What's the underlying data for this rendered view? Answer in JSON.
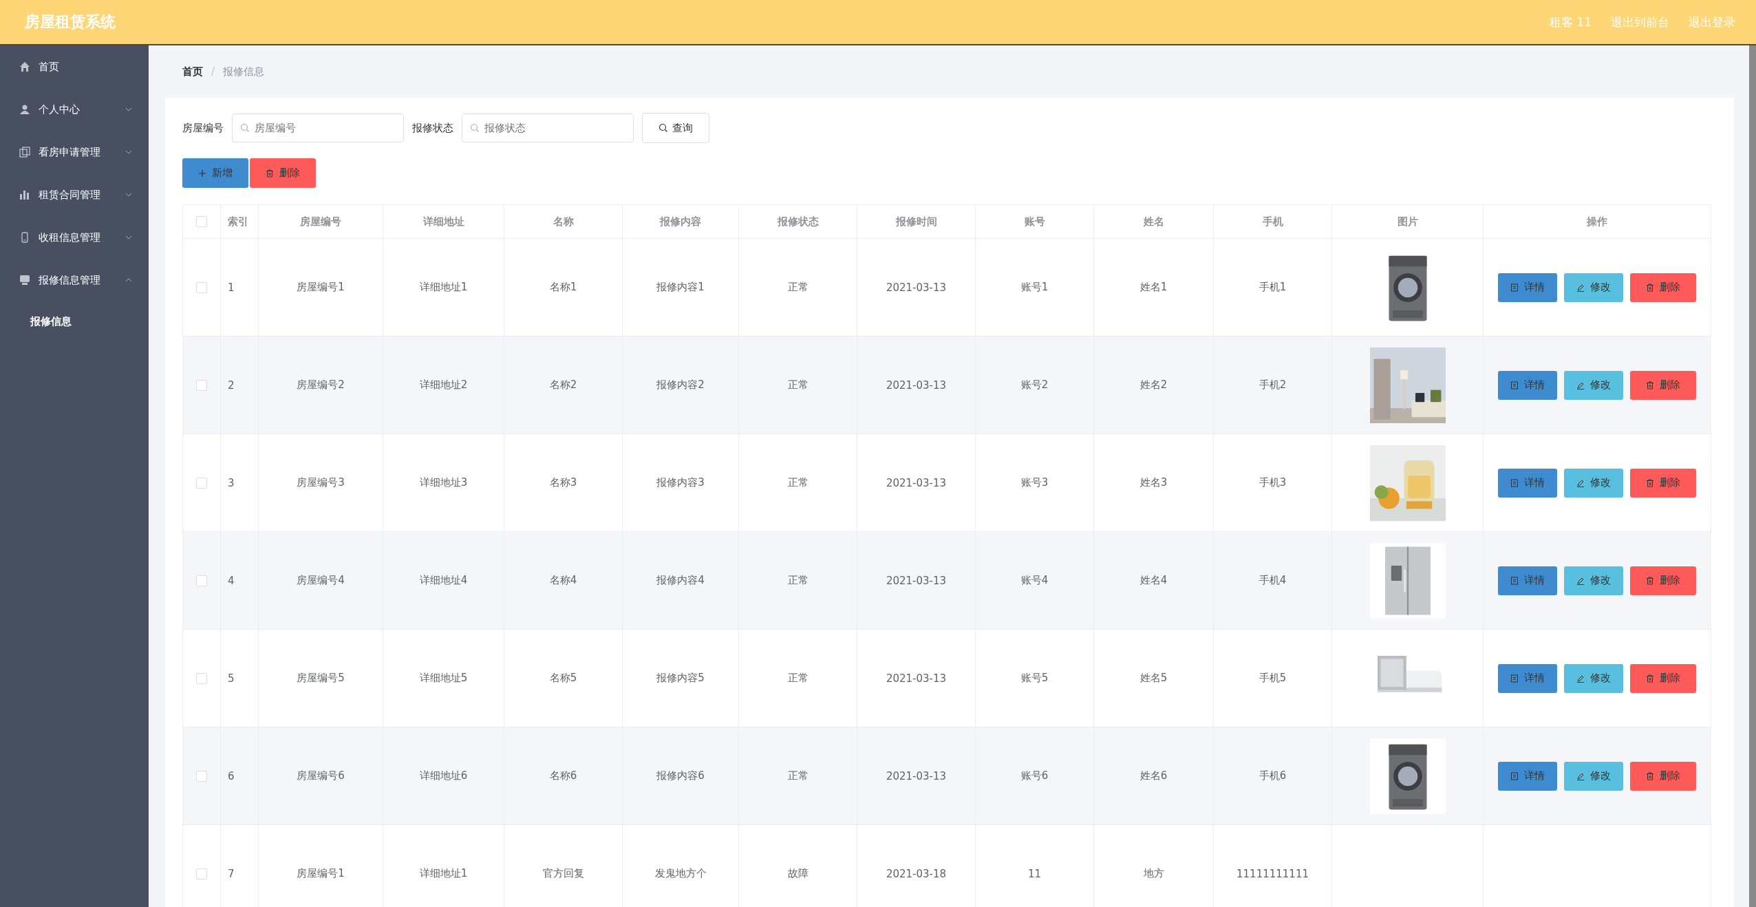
{
  "header": {
    "title": "房屋租赁系统",
    "links": [
      {
        "label": "租客 11"
      },
      {
        "label": "退出到前台"
      },
      {
        "label": "退出登录"
      }
    ]
  },
  "sidebar": {
    "items": [
      {
        "label": "首页"
      },
      {
        "label": "个人中心",
        "expanded": false
      },
      {
        "label": "看房申请管理",
        "expanded": false
      },
      {
        "label": "租赁合同管理",
        "expanded": false
      },
      {
        "label": "收租信息管理",
        "expanded": false
      },
      {
        "label": "报修信息管理",
        "expanded": true,
        "children": [
          {
            "label": "报修信息",
            "selected": true
          }
        ]
      }
    ]
  },
  "breadcrumb": {
    "separator": "/",
    "items": [
      {
        "label": "首页"
      },
      {
        "label": "报修信息"
      }
    ]
  },
  "search": {
    "fields": [
      {
        "label": "房屋编号",
        "placeholder": "房屋编号"
      },
      {
        "label": "报修状态",
        "placeholder": "报修状态"
      }
    ],
    "button": "查询"
  },
  "toolbar": [
    {
      "kind": "add",
      "label": "新增"
    },
    {
      "kind": "delete",
      "label": "删除"
    }
  ],
  "table": {
    "header_checked": false,
    "columns": [
      "索引",
      "房屋编号",
      "详细地址",
      "名称",
      "报修内容",
      "报修状态",
      "报修时间",
      "账号",
      "姓名",
      "手机",
      "图片",
      "操作"
    ],
    "rows": [
      {
        "checked": false,
        "cells": [
          "1",
          "房屋编号1",
          "详细地址1",
          "名称1",
          "报修内容1",
          "正常",
          "2021-03-13",
          "账号1",
          "姓名1",
          "手机1"
        ],
        "actions": [
          {
            "kind": "detail",
            "label": "详情"
          },
          {
            "kind": "edit",
            "label": "修改"
          },
          {
            "kind": "delete",
            "label": "删除"
          }
        ]
      },
      {
        "checked": false,
        "cells": [
          "2",
          "房屋编号2",
          "详细地址2",
          "名称2",
          "报修内容2",
          "正常",
          "2021-03-13",
          "账号2",
          "姓名2",
          "手机2"
        ],
        "actions": [
          {
            "kind": "detail",
            "label": "详情"
          },
          {
            "kind": "edit",
            "label": "修改"
          },
          {
            "kind": "delete",
            "label": "删除"
          }
        ]
      },
      {
        "checked": false,
        "cells": [
          "3",
          "房屋编号3",
          "详细地址3",
          "名称3",
          "报修内容3",
          "正常",
          "2021-03-13",
          "账号3",
          "姓名3",
          "手机3"
        ],
        "actions": [
          {
            "kind": "detail",
            "label": "详情"
          },
          {
            "kind": "edit",
            "label": "修改"
          },
          {
            "kind": "delete",
            "label": "删除"
          }
        ]
      },
      {
        "checked": false,
        "cells": [
          "4",
          "房屋编号4",
          "详细地址4",
          "名称4",
          "报修内容4",
          "正常",
          "2021-03-13",
          "账号4",
          "姓名4",
          "手机4"
        ],
        "actions": [
          {
            "kind": "detail",
            "label": "详情"
          },
          {
            "kind": "edit",
            "label": "修改"
          },
          {
            "kind": "delete",
            "label": "删除"
          }
        ]
      },
      {
        "checked": false,
        "cells": [
          "5",
          "房屋编号5",
          "详细地址5",
          "名称5",
          "报修内容5",
          "正常",
          "2021-03-13",
          "账号5",
          "姓名5",
          "手机5"
        ],
        "actions": [
          {
            "kind": "detail",
            "label": "详情"
          },
          {
            "kind": "edit",
            "label": "修改"
          },
          {
            "kind": "delete",
            "label": "删除"
          }
        ]
      },
      {
        "checked": false,
        "cells": [
          "6",
          "房屋编号6",
          "详细地址6",
          "名称6",
          "报修内容6",
          "正常",
          "2021-03-13",
          "账号6",
          "姓名6",
          "手机6"
        ],
        "actions": [
          {
            "kind": "detail",
            "label": "详情"
          },
          {
            "kind": "edit",
            "label": "修改"
          },
          {
            "kind": "delete",
            "label": "删除"
          }
        ]
      },
      {
        "checked": false,
        "cells": [
          "7",
          "房屋编号1",
          "详细地址1",
          "官方回复",
          "发鬼地方个",
          "故障",
          "2021-03-18",
          "11",
          "地方",
          "11111111111"
        ]
      }
    ]
  }
}
